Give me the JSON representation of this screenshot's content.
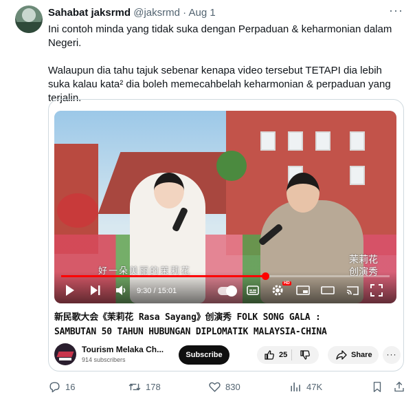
{
  "tweet": {
    "author_name": "Sahabat jaksrmd",
    "handle": "@jaksrmd",
    "separator": "·",
    "date": "Aug 1",
    "more_icon": "ellipsis-icon",
    "paragraphs": [
      "Ini contoh minda yang tidak suka dengan Perpaduan & keharmonian dalam Negeri.",
      "Walaupun dia tahu tajuk sebenar kenapa video tersebut TETAPI dia lebih suka kalau kata² dia boleh memecahbelah keharmonian  & perpaduan yang terjalin."
    ]
  },
  "video": {
    "subtitle": "好一朵美丽的茉莉花",
    "logo_text": "茉莉花",
    "logo_sub": "创演秀",
    "time": "9:30 / 15:01",
    "progress": 0.621,
    "hd_badge": "HD",
    "title_line1": "新民歌大会《茉莉花 Rasa Sayang》创演秀 FOLK SONG GALA :",
    "title_line2": "SAMBUTAN 50 TAHUN HUBUNGAN DIPLOMATIK MALAYSIA-CHINA"
  },
  "channel": {
    "name": "Tourism Melaka Ch...",
    "subscribers": "914 subscribers",
    "subscribe_label": "Subscribe",
    "likes": "25",
    "share_label": "Share"
  },
  "actions": {
    "replies": "16",
    "retweets": "178",
    "likes": "830",
    "views": "47K"
  },
  "colors": {
    "progress": "#ff0000",
    "muted_text": "#536471",
    "border": "#cfd9de"
  }
}
